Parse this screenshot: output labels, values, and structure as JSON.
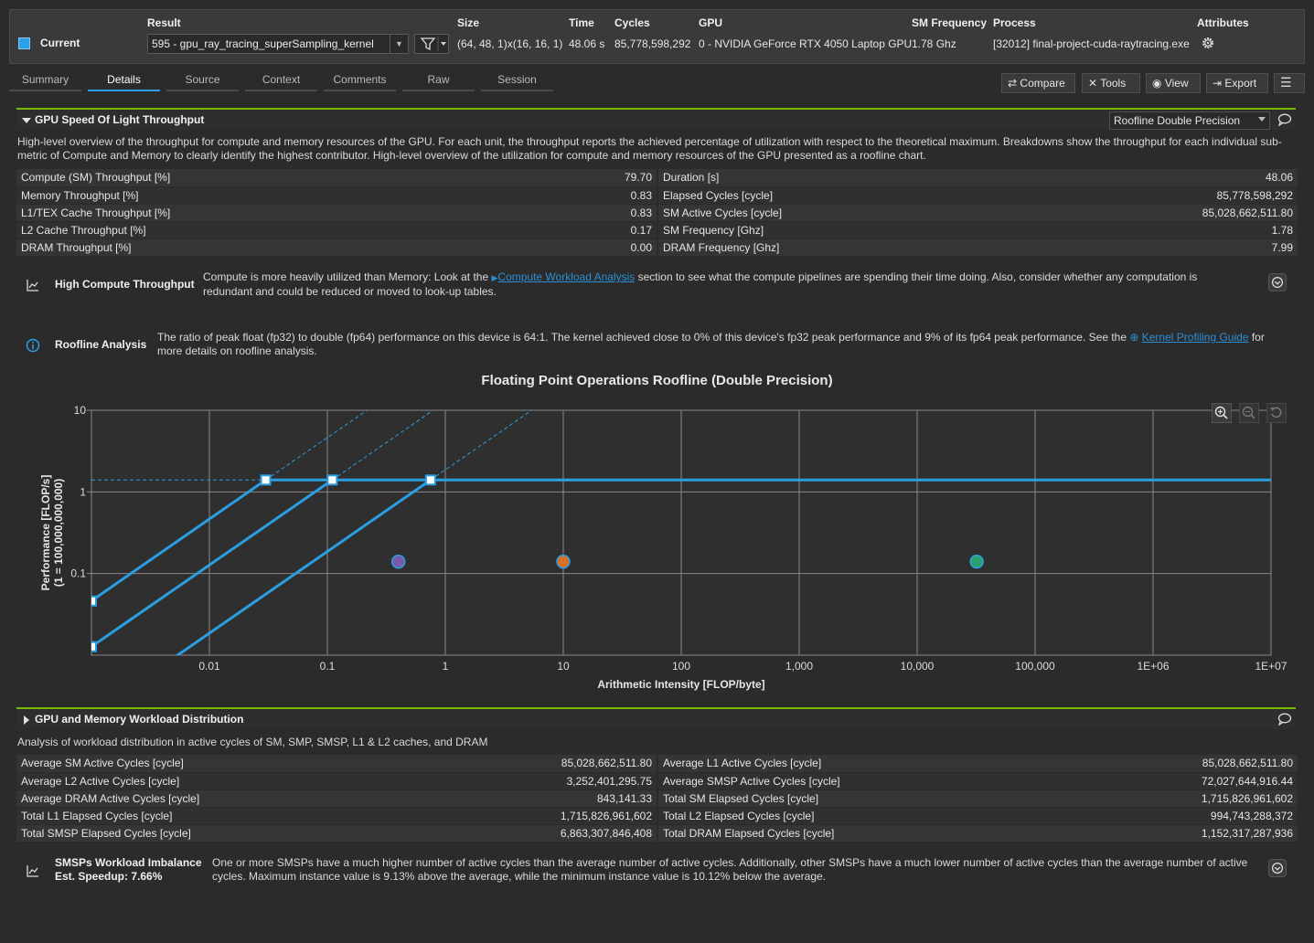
{
  "header": {
    "labels": {
      "result": "Result",
      "size": "Size",
      "time": "Time",
      "cycles": "Cycles",
      "gpu": "GPU",
      "sm_frequency": "SM Frequency",
      "process": "Process",
      "attributes": "Attributes"
    },
    "current_label": "Current",
    "result_value": "595 - gpu_ray_tracing_superSampling_kernel",
    "size": "(64, 48, 1)x(16, 16, 1)",
    "time": "48.06 s",
    "cycles": "85,778,598,292",
    "gpu": "0 - NVIDIA GeForce RTX 4050 Laptop GPU",
    "sm_frequency": "1.78 Ghz",
    "process": "[32012] final-project-cuda-raytracing.exe"
  },
  "tabs": [
    "Summary",
    "Details",
    "Source",
    "Context",
    "Comments",
    "Raw",
    "Session"
  ],
  "active_tab": "Details",
  "toolbar": {
    "compare": "Compare",
    "tools": "Tools",
    "view": "View",
    "export": "Export"
  },
  "sol": {
    "title": "GPU Speed Of Light Throughput",
    "dropdown": "Roofline Double Precision",
    "description": "High-level overview of the throughput for compute and memory resources of the GPU. For each unit, the throughput reports the achieved percentage of utilization with respect to the theoretical maximum. Breakdowns show the throughput for each individual sub-metric of Compute and Memory to clearly identify the highest contributor. High-level overview of the utilization for compute and memory resources of the GPU presented as a roofline chart.",
    "left_metrics": [
      {
        "name": "Compute (SM) Throughput [%]",
        "value": "79.70"
      },
      {
        "name": "Memory Throughput [%]",
        "value": "0.83"
      },
      {
        "name": "L1/TEX Cache Throughput [%]",
        "value": "0.83"
      },
      {
        "name": "L2 Cache Throughput [%]",
        "value": "0.17"
      },
      {
        "name": "DRAM Throughput [%]",
        "value": "0.00"
      }
    ],
    "right_metrics": [
      {
        "name": "Duration [s]",
        "value": "48.06"
      },
      {
        "name": "Elapsed Cycles [cycle]",
        "value": "85,778,598,292"
      },
      {
        "name": "SM Active Cycles [cycle]",
        "value": "85,028,662,511.80"
      },
      {
        "name": "SM Frequency [Ghz]",
        "value": "1.78"
      },
      {
        "name": "DRAM Frequency [Ghz]",
        "value": "7.99"
      }
    ],
    "rule1": {
      "title": "High Compute Throughput",
      "text_before": "Compute is more heavily utilized than Memory: Look at the ",
      "link": "Compute Workload Analysis",
      "text_after": " section to see what the compute pipelines are spending their time doing. Also, consider whether any computation is redundant and could be reduced or moved to look-up tables."
    },
    "rule2": {
      "title": "Roofline Analysis",
      "text_before": "The ratio of peak float (fp32) to double (fp64) performance on this device is 64:1. The kernel achieved close to 0% of this device's fp32 peak performance and 9% of its fp64 peak performance. See the ",
      "link": "Kernel Profiling Guide",
      "text_after": " for more details on roofline analysis."
    }
  },
  "chart_data": {
    "type": "scatter",
    "title": "Floating Point Operations Roofline (Double Precision)",
    "xlabel": "Arithmetic Intensity [FLOP/byte]",
    "ylabel": "Performance [FLOP/s]",
    "ylabel2": "(1 = 100,000,000,000)",
    "x_scale": "log",
    "y_scale": "log",
    "x_ticks": [
      0.01,
      0.1,
      1,
      10,
      100,
      1000,
      10000,
      100000,
      1000000,
      10000000
    ],
    "x_tick_labels": [
      "0.01",
      "0.1",
      "1",
      "10",
      "100",
      "1,000",
      "10,000",
      "100,000",
      "1E+06",
      "1E+07"
    ],
    "y_ticks": [
      0.1,
      1,
      10
    ],
    "y_tick_labels": [
      "0.1",
      "1",
      "10"
    ],
    "xlim": [
      0.001,
      10000000
    ],
    "ylim": [
      0.01,
      10
    ],
    "peak_performance": 1.4,
    "rooflines": [
      {
        "name": "memory-1",
        "bandwidth": 46,
        "ridge": 0.03
      },
      {
        "name": "memory-2",
        "bandwidth": 12.7,
        "ridge": 0.11
      },
      {
        "name": "memory-3",
        "bandwidth": 1.85,
        "ridge": 0.75
      }
    ],
    "extra_markers": [
      {
        "x": 0.001,
        "y": 0.046
      },
      {
        "x": 0.001,
        "y": 0.0127
      }
    ],
    "points": [
      {
        "x": 0.4,
        "y": 0.14,
        "color": "#7a5aa8"
      },
      {
        "x": 10,
        "y": 0.14,
        "color": "#d8702a"
      },
      {
        "x": 32000,
        "y": 0.14,
        "color": "#2aa070"
      }
    ],
    "line_color": "#2a9ee0",
    "grid": true
  },
  "workload": {
    "title": "GPU and Memory Workload Distribution",
    "description": "Analysis of workload distribution in active cycles of SM, SMP, SMSP, L1 & L2 caches, and DRAM",
    "left_metrics": [
      {
        "name": "Average SM Active Cycles [cycle]",
        "value": "85,028,662,511.80"
      },
      {
        "name": "Average L2 Active Cycles [cycle]",
        "value": "3,252,401,295.75"
      },
      {
        "name": "Average DRAM Active Cycles [cycle]",
        "value": "843,141.33"
      },
      {
        "name": "Total L1 Elapsed Cycles [cycle]",
        "value": "1,715,826,961,602"
      },
      {
        "name": "Total SMSP Elapsed Cycles [cycle]",
        "value": "6,863,307,846,408"
      }
    ],
    "right_metrics": [
      {
        "name": "Average L1 Active Cycles [cycle]",
        "value": "85,028,662,511.80"
      },
      {
        "name": "Average SMSP Active Cycles [cycle]",
        "value": "72,027,644,916.44"
      },
      {
        "name": "Total SM Elapsed Cycles [cycle]",
        "value": "1,715,826,961,602"
      },
      {
        "name": "Total L2 Elapsed Cycles [cycle]",
        "value": "994,743,288,372"
      },
      {
        "name": "Total DRAM Elapsed Cycles [cycle]",
        "value": "1,152,317,287,936"
      }
    ],
    "rule": {
      "title": "SMSPs Workload Imbalance",
      "speedup": "Est. Speedup: 7.66%",
      "text": "One or more SMSPs have a much higher number of active cycles than the average number of active cycles. Additionally, other SMSPs have a much lower number of active cycles than the average number of active cycles. Maximum instance value is 9.13% above the average, while the minimum instance value is 10.12% below the average."
    }
  },
  "icons": [
    "gear-icon",
    "filter-icon",
    "compare-icon",
    "tools-icon",
    "view-icon",
    "export-icon",
    "menu-icon",
    "chart-icon",
    "info-icon",
    "comment-icon",
    "expand-icon",
    "zoom-in-icon",
    "zoom-out-icon",
    "reset-icon"
  ],
  "colors": {
    "accent": "#2aa0e6",
    "section_border": "#76b900",
    "link": "#2a8fd6"
  }
}
